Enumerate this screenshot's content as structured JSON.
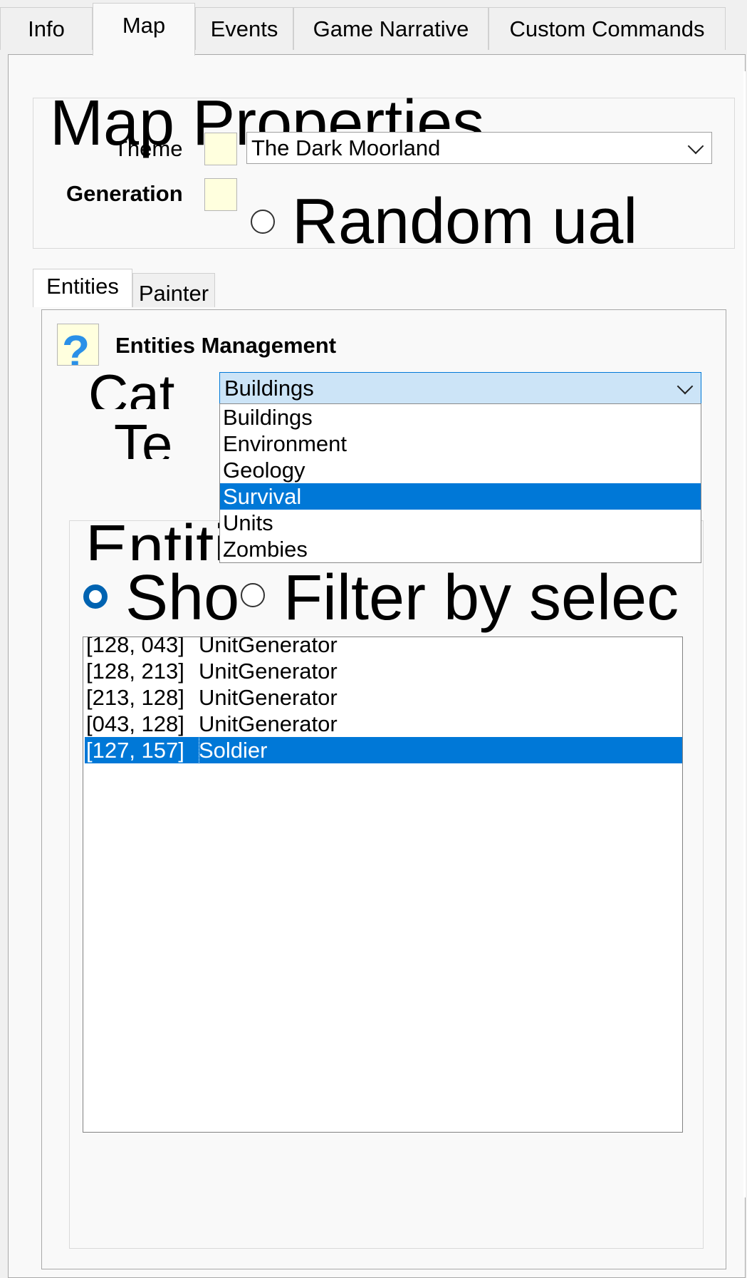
{
  "tabs": [
    {
      "label": "Info"
    },
    {
      "label": "Map"
    },
    {
      "label": "Events"
    },
    {
      "label": "Game Narrative"
    },
    {
      "label": "Custom Commands"
    }
  ],
  "map_properties": {
    "title": "Map Properties",
    "theme_label": "Theme",
    "theme_value": "The Dark Moorland",
    "generation_label": "Generation",
    "generation_option": "Random ual"
  },
  "subtabs": [
    {
      "label": "Entities"
    },
    {
      "label": "Painter"
    }
  ],
  "entities": {
    "help_glyph": "?",
    "title": "Entities Management",
    "category_label": "Cat",
    "type_label": "Te",
    "category_value": "Buildings",
    "category_options": [
      "Buildings",
      "Environment",
      "Geology",
      "Survival",
      "Units",
      "Zombies"
    ],
    "selected_option": "Survival",
    "created_title": "Entities created",
    "show_label": "Sho",
    "filter_label": "Filter by selec"
  },
  "entity_list": [
    {
      "coord": "[128, 043]",
      "name": "UnitGenerator"
    },
    {
      "coord": "[128, 213]",
      "name": "UnitGenerator"
    },
    {
      "coord": "[213, 128]",
      "name": "UnitGenerator"
    },
    {
      "coord": "[043, 128]",
      "name": "UnitGenerator"
    },
    {
      "coord": "[127, 157]",
      "name": "Soldier"
    }
  ],
  "colors": {
    "accent": "#0078d7",
    "field_yellow": "#ffffde"
  }
}
